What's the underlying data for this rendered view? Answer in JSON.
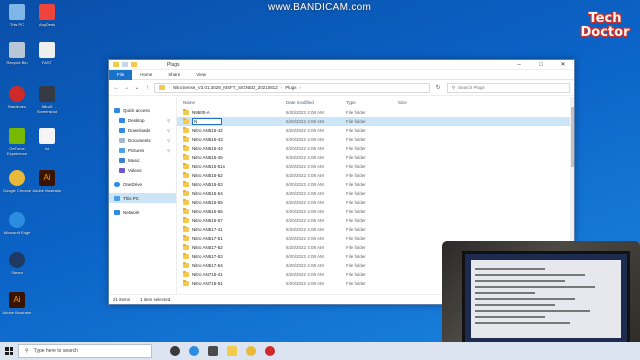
{
  "watermark": "www.BANDICAM.com",
  "logo": {
    "line1": "Tech",
    "line2": "Doctor"
  },
  "desktop_icons": [
    {
      "label": "This PC",
      "color": "#7fb6e8"
    },
    {
      "label": "Recycle Bin",
      "color": "#b8c7d6"
    },
    {
      "label": "Bandicam",
      "color": "#cf2a2a"
    },
    {
      "label": "GeForce Experience",
      "color": "#76b900"
    },
    {
      "label": "Google Chrome",
      "color": "#e9b93a"
    },
    {
      "label": "Microsoft Edge",
      "color": "#2b8de0"
    },
    {
      "label": "Steam",
      "color": "#1f3a62"
    },
    {
      "label": "Adobe Illustrator",
      "color": "#3a1400"
    },
    {
      "label": "AnyDesk",
      "color": "#ef443b"
    },
    {
      "label": "FAST",
      "color": "#eeeeee"
    },
    {
      "label": "Nitro5 Screenshot",
      "color": "#353a44"
    },
    {
      "label": "txt",
      "color": "#f4f4f4"
    },
    {
      "label": "Adobe Illustrator",
      "color": "#3a1400"
    }
  ],
  "window": {
    "title": "Plugs",
    "tabs": [
      "File",
      "Home",
      "Share",
      "View"
    ],
    "breadcrumb": [
      "NitroSense_V3.01.3028_MSFT_SIGNED_20210812",
      "Plugs"
    ],
    "search_placeholder": "Search Plugs",
    "nav": {
      "quick_access": "Quick access",
      "pinned": [
        "Desktop",
        "Downloads",
        "Documents",
        "Pictures"
      ],
      "others": [
        "Music",
        "Videos"
      ],
      "onedrive": "OneDrive",
      "this_pc": "This PC",
      "network": "Network"
    },
    "columns": {
      "name": "Name",
      "date": "Date modified",
      "type": "Type",
      "size": "Size"
    },
    "rename_value": "N",
    "rows": [
      {
        "name": "N9500-A",
        "date": "6/20/2022 4:08 AM",
        "type": "File folder"
      },
      {
        "name": "",
        "date": "6/20/2022 4:09 AM",
        "type": "File folder"
      },
      {
        "name": "Nitro AN515-42",
        "date": "6/20/2022 4:08 AM",
        "type": "File folder"
      },
      {
        "name": "Nitro AN515-43",
        "date": "6/20/2022 4:08 AM",
        "type": "File folder"
      },
      {
        "name": "Nitro AN515-44",
        "date": "6/20/2022 4:08 AM",
        "type": "File folder"
      },
      {
        "name": "Nitro AN515-45",
        "date": "6/20/2022 4:08 AM",
        "type": "File folder"
      },
      {
        "name": "Nitro AN515-51s",
        "date": "6/20/2022 4:08 AM",
        "type": "File folder"
      },
      {
        "name": "Nitro AN515-52",
        "date": "6/20/2022 4:08 AM",
        "type": "File folder"
      },
      {
        "name": "Nitro AN515-53",
        "date": "6/20/2022 4:08 AM",
        "type": "File folder"
      },
      {
        "name": "Nitro AN515-54",
        "date": "6/20/2022 4:08 AM",
        "type": "File folder"
      },
      {
        "name": "Nitro AN515-55",
        "date": "6/20/2022 4:08 AM",
        "type": "File folder"
      },
      {
        "name": "Nitro AN515-56",
        "date": "6/20/2022 4:08 AM",
        "type": "File folder"
      },
      {
        "name": "Nitro AN515-57",
        "date": "6/20/2022 4:08 AM",
        "type": "File folder"
      },
      {
        "name": "Nitro AN517-41",
        "date": "6/20/2022 4:08 AM",
        "type": "File folder"
      },
      {
        "name": "Nitro AN517-51",
        "date": "6/20/2022 4:08 AM",
        "type": "File folder"
      },
      {
        "name": "Nitro AN517-52",
        "date": "6/20/2022 4:08 AM",
        "type": "File folder"
      },
      {
        "name": "Nitro AN517-53",
        "date": "6/20/2022 4:08 AM",
        "type": "File folder"
      },
      {
        "name": "Nitro AN517-54",
        "date": "6/20/2022 4:08 AM",
        "type": "File folder"
      },
      {
        "name": "Nitro AN715-41",
        "date": "6/20/2022 4:08 AM",
        "type": "File folder"
      },
      {
        "name": "Nitro AN715-51",
        "date": "6/20/2022 4:08 AM",
        "type": "File folder"
      }
    ],
    "status": {
      "count": "21 items",
      "selected": "1 item selected"
    }
  },
  "taskbar": {
    "search_placeholder": "Type here to search",
    "icons": [
      {
        "name": "task-view-icon",
        "color": "#3a3a3a"
      },
      {
        "name": "edge-icon",
        "color": "#2b8de0"
      },
      {
        "name": "store-icon",
        "color": "#4a4a4a"
      },
      {
        "name": "file-explorer-icon",
        "color": "#f3c94e"
      },
      {
        "name": "chrome-icon",
        "color": "#e9b93a"
      },
      {
        "name": "bandicam-icon",
        "color": "#cf2a2a"
      }
    ]
  }
}
